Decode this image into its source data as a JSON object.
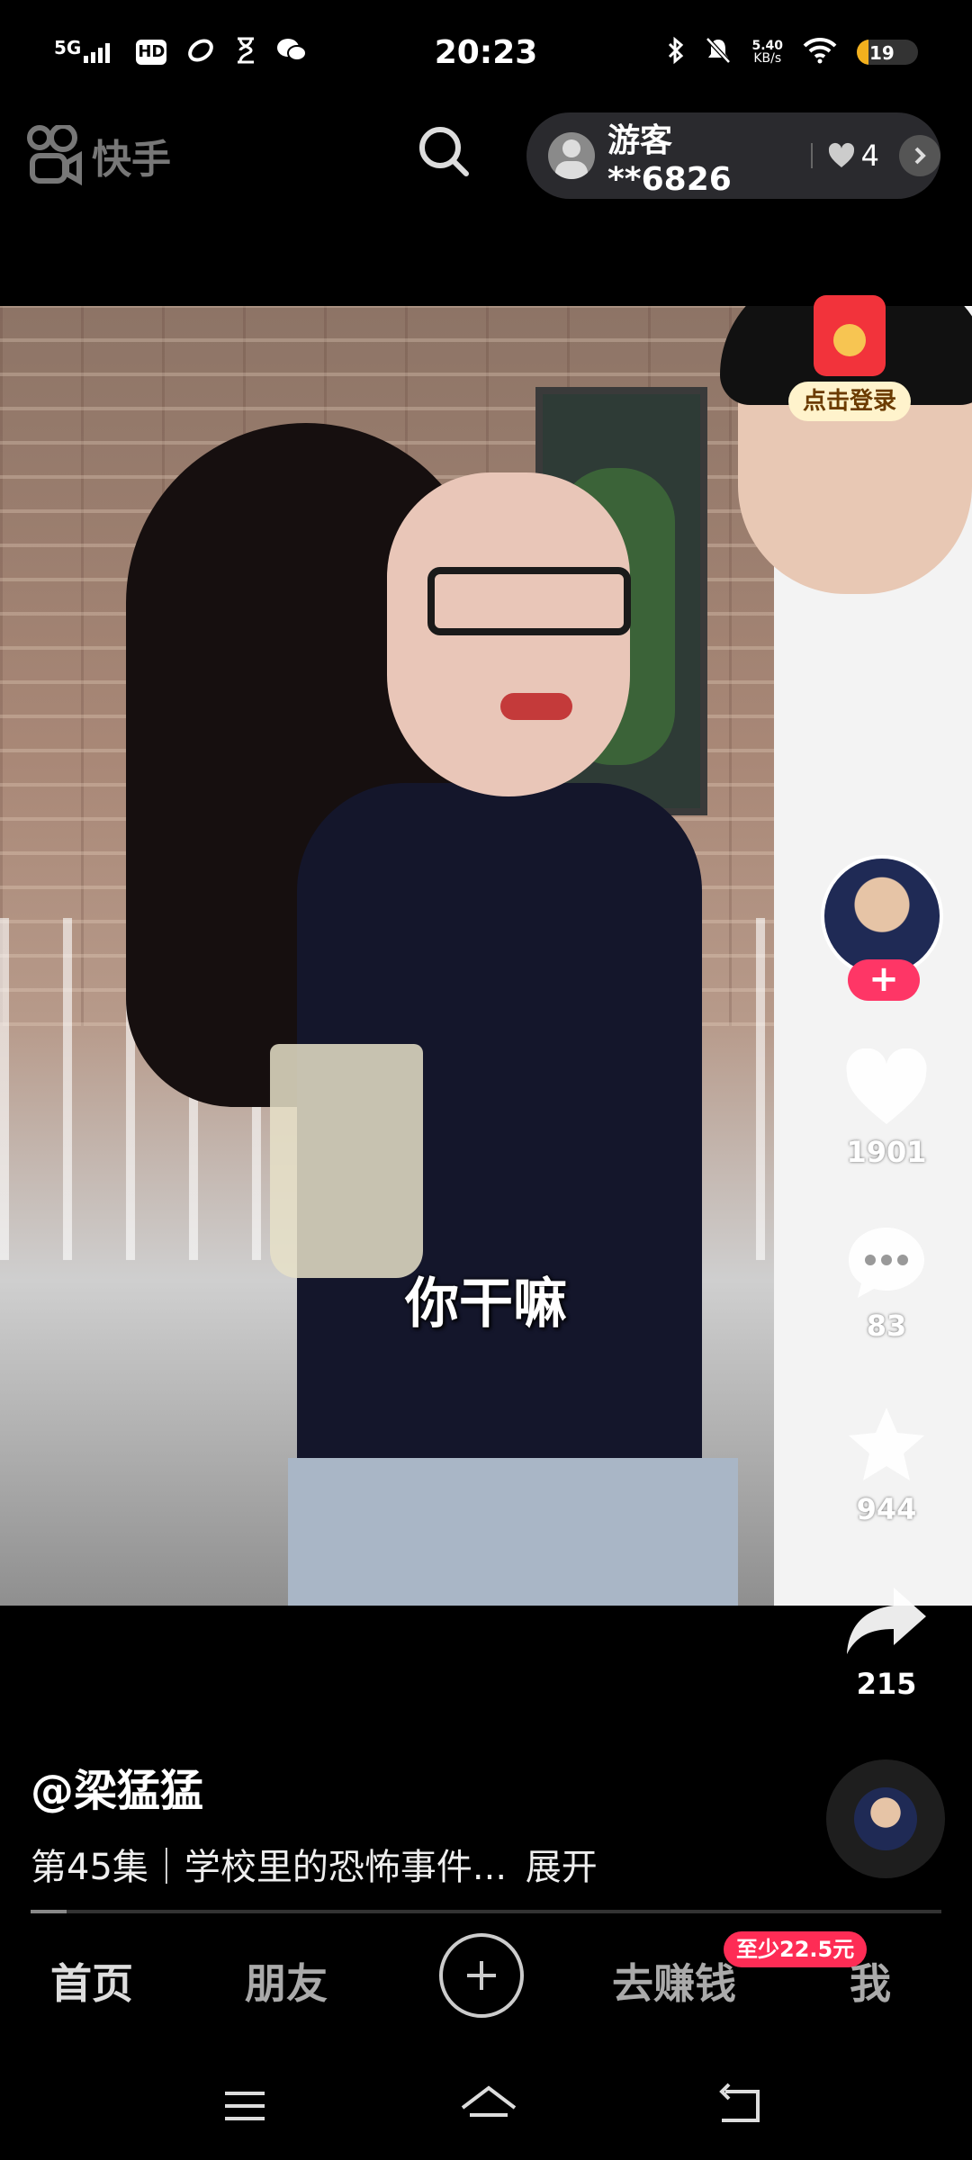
{
  "status_bar": {
    "network": "5G",
    "hd": "HD",
    "time": "20:23",
    "speed_value": "5.40",
    "speed_unit": "KB/s",
    "battery": "19",
    "battery_level": 0.19
  },
  "app_bar": {
    "logo_text": "快手",
    "user_name": "游客**6826",
    "likes": "4"
  },
  "video": {
    "subtitle": "你干嘛"
  },
  "redpacket": {
    "label": "点击登录"
  },
  "actions": {
    "follow": "+",
    "likes": "1901",
    "comments": "83",
    "favorites": "944",
    "shares": "215"
  },
  "info": {
    "author": "@梁猛猛",
    "description": "第45集｜学校里的恐怖事件...",
    "more": "展开",
    "progress": 0.04
  },
  "bottom_nav": {
    "home": "首页",
    "friends": "朋友",
    "earn": "去赚钱",
    "earn_badge": "至少22.5元",
    "me": "我"
  }
}
